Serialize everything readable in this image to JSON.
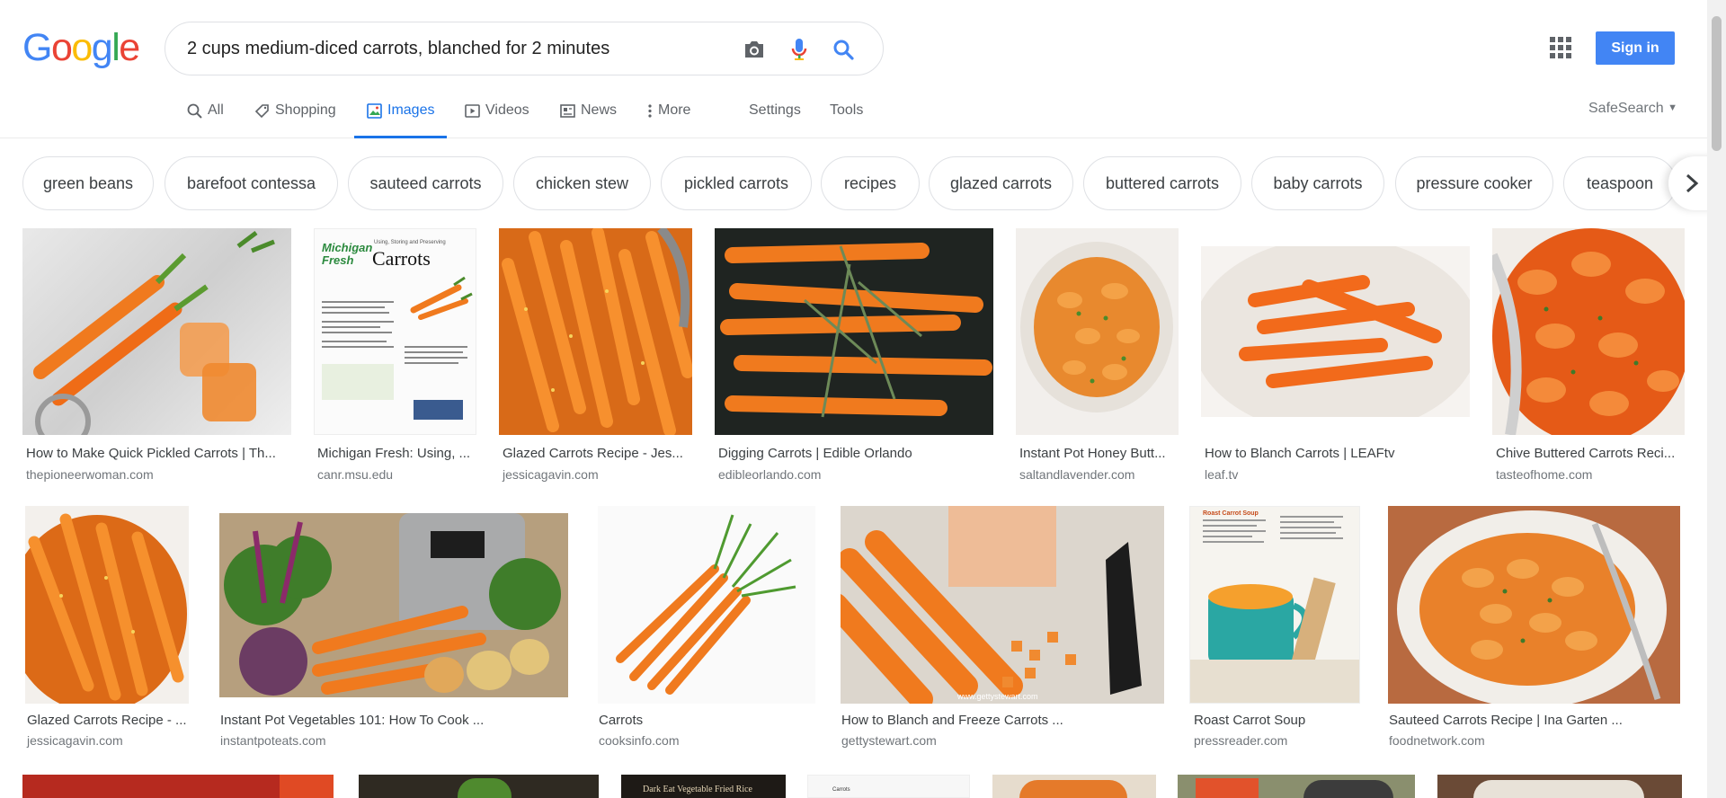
{
  "logo": {
    "letters": [
      "G",
      "o",
      "o",
      "g",
      "l",
      "e"
    ]
  },
  "search": {
    "value": "2 cups medium-diced carrots, blanched for 2 minutes",
    "icons": [
      "camera-icon",
      "microphone-icon",
      "search-icon"
    ]
  },
  "header": {
    "signin_label": "Sign in",
    "apps_icon": "apps-grid-icon"
  },
  "tabs": [
    {
      "label": "All",
      "icon": "search-icon"
    },
    {
      "label": "Shopping",
      "icon": "tag-icon"
    },
    {
      "label": "Images",
      "icon": "image-icon",
      "active": true
    },
    {
      "label": "Videos",
      "icon": "play-icon"
    },
    {
      "label": "News",
      "icon": "newspaper-icon"
    },
    {
      "label": "More",
      "icon": "more-vert-icon"
    },
    {
      "label": "Settings"
    },
    {
      "label": "Tools"
    }
  ],
  "safesearch": {
    "label": "SafeSearch"
  },
  "chips": [
    "green beans",
    "barefoot contessa",
    "sauteed carrots",
    "chicken stew",
    "pickled carrots",
    "recipes",
    "glazed carrots",
    "buttered carrots",
    "baby carrots",
    "pressure cooker",
    "teaspoon"
  ],
  "results_row1": [
    {
      "title": "How to Make Quick Pickled Carrots | Th...",
      "site": "thepioneerwoman.com"
    },
    {
      "title": "Michigan Fresh: Using, ...",
      "site": "canr.msu.edu"
    },
    {
      "title": "Glazed Carrots Recipe - Jes...",
      "site": "jessicagavin.com"
    },
    {
      "title": "Digging Carrots | Edible Orlando",
      "site": "edibleorlando.com"
    },
    {
      "title": "Instant Pot Honey Butt...",
      "site": "saltandlavender.com"
    },
    {
      "title": "How to Blanch Carrots | LEAFtv",
      "site": "leaf.tv"
    },
    {
      "title": "Chive Buttered Carrots Reci...",
      "site": "tasteofhome.com"
    }
  ],
  "results_row2": [
    {
      "title": "Glazed Carrots Recipe - ...",
      "site": "jessicagavin.com"
    },
    {
      "title": "Instant Pot Vegetables 101: How To Cook ...",
      "site": "instantpoteats.com"
    },
    {
      "title": "Carrots",
      "site": "cooksinfo.com"
    },
    {
      "title": "How to Blanch and Freeze Carrots ...",
      "site": "gettystewart.com"
    },
    {
      "title": "Roast Carrot Soup",
      "site": "pressreader.com"
    },
    {
      "title": "Sauteed Carrots Recipe | Ina Garten ...",
      "site": "foodnetwork.com"
    }
  ],
  "thumb_text": {
    "flyer_title": "Carrots",
    "flyer_brand": "Michigan Fresh",
    "flyer_sub": "Using, Storing and Preserving",
    "soup_label": "Roast Carrot Soup",
    "rice_label": "Dark Eat Vegetable Fried Rice",
    "carrots_tag": "Carrots",
    "watermark": "www.gettystewart.com"
  },
  "colors": {
    "accent": "#1a73e8",
    "signin": "#4285f4",
    "carrot": "#f07a1e",
    "muted": "#70757a"
  }
}
